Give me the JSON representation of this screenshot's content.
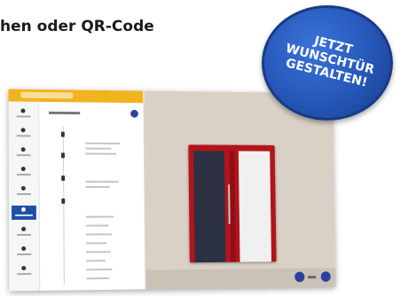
{
  "headline": "hen oder QR-Code",
  "badge": {
    "line1": "JETZT",
    "line2": "WUNSCHTÜR",
    "line3": "GESTALTEN!"
  },
  "colors": {
    "accent": "#f1b41e",
    "primary": "#2b3fa0",
    "door_frame": "#b3141c",
    "door_panel": "#2c3141",
    "badge": "#2557b8"
  }
}
